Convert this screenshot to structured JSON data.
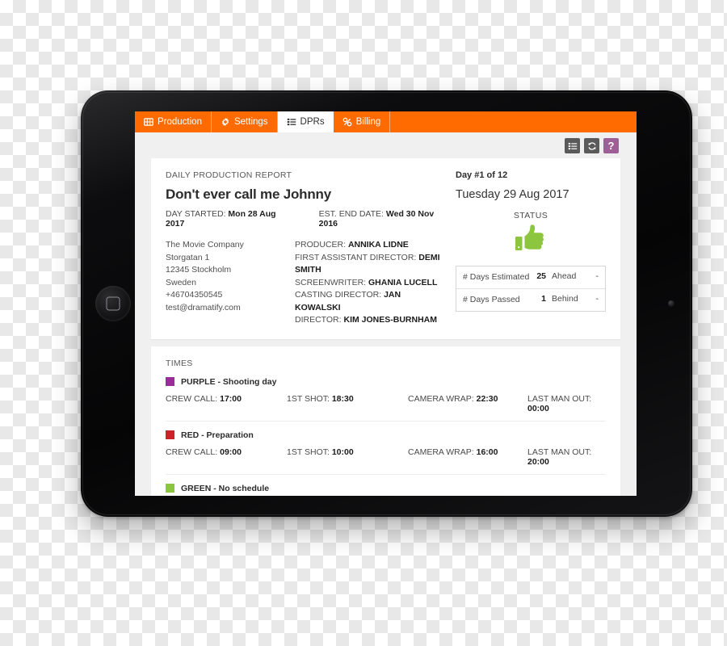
{
  "nav": {
    "tabs": [
      {
        "label": "Production",
        "icon": "film-grid-icon",
        "active": false
      },
      {
        "label": "Settings",
        "icon": "gear-icon",
        "active": false
      },
      {
        "label": "DPRs",
        "icon": "list-icon",
        "active": true
      },
      {
        "label": "Billing",
        "icon": "tag-icon",
        "active": false
      }
    ]
  },
  "toolbar": {
    "list_view_label": "list-view",
    "refresh_label": "refresh",
    "help_label": "?"
  },
  "report": {
    "kicker": "DAILY PRODUCTION REPORT",
    "title": "Don't ever call me Johnny",
    "day_started_label": "DAY STARTED:",
    "day_started_value": "Mon 28 Aug 2017",
    "est_end_label": "EST. END DATE:",
    "est_end_value": "Wed 30 Nov 2016",
    "company": [
      "The Movie Company",
      "Storgatan 1",
      "12345 Stockholm",
      "Sweden",
      "+46704350545",
      "test@dramatify.com"
    ],
    "crew": [
      {
        "role": "PRODUCER:",
        "name": "ANNIKA LIDNE"
      },
      {
        "role": "FIRST ASSISTANT DIRECTOR:",
        "name": "DEMI SMITH"
      },
      {
        "role": "SCREENWRITER:",
        "name": "GHANIA LUCELL"
      },
      {
        "role": "CASTING DIRECTOR:",
        "name": "JAN KOWALSKI"
      },
      {
        "role": "DIRECTOR:",
        "name": "KIM JONES-BURNHAM"
      }
    ]
  },
  "status": {
    "day_count": "Day #1 of 12",
    "date": "Tuesday 29 Aug 2017",
    "heading": "STATUS",
    "icon": "thumbs-up-icon",
    "icon_color": "#8cc63e",
    "rows": [
      {
        "label": "# Days Estimated",
        "number": "25",
        "state": "Ahead",
        "dash": "-"
      },
      {
        "label": "# Days Passed",
        "number": "1",
        "state": "Behind",
        "dash": "-"
      }
    ]
  },
  "times": {
    "heading": "TIMES",
    "labels": {
      "crew_call": "CREW CALL:",
      "first_shot": "1ST SHOT:",
      "camera_wrap": "CAMERA WRAP:",
      "last_man_out": "LAST MAN OUT:"
    },
    "blocks": [
      {
        "swatch_color": "#9b2d9b",
        "label": "PURPLE - Shooting day",
        "has_times": true,
        "crew_call": "17:00",
        "first_shot": "18:30",
        "camera_wrap": "22:30",
        "last_man_out": "00:00"
      },
      {
        "swatch_color": "#cc2229",
        "label": "RED - Preparation",
        "has_times": true,
        "crew_call": "09:00",
        "first_shot": "10:00",
        "camera_wrap": "16:00",
        "last_man_out": "20:00"
      },
      {
        "swatch_color": "#8cc63e",
        "label": "GREEN - No schedule",
        "has_times": false,
        "crew_call": "",
        "first_shot": "",
        "camera_wrap": "",
        "last_man_out": ""
      }
    ]
  },
  "theme": {
    "accent_orange": "#ff6b00",
    "help_purple": "#9c5f96",
    "toolbar_gray": "#5a5a5a",
    "page_bg": "#f0f0f0"
  }
}
